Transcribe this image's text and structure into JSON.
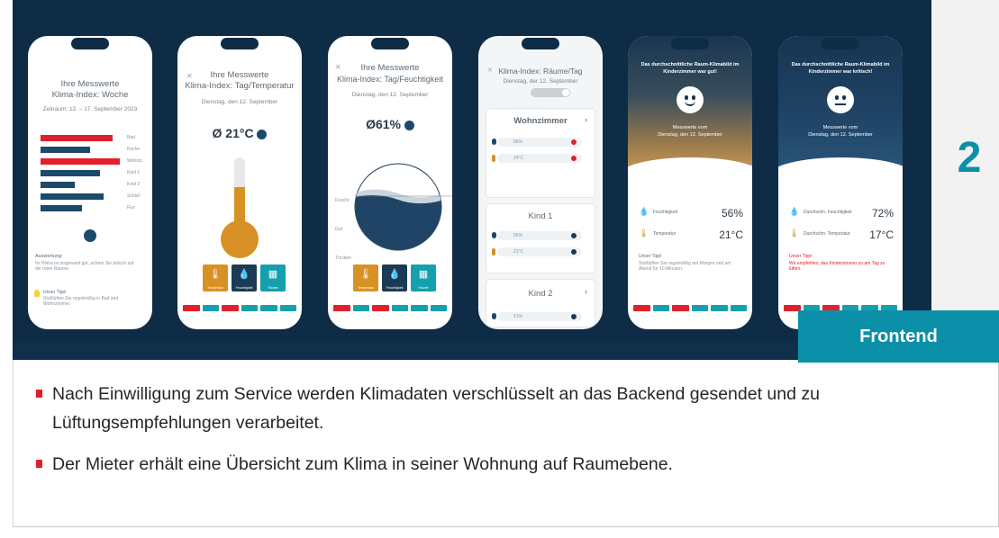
{
  "slide": {
    "step_number": "2",
    "section_tag": "Frontend"
  },
  "phones": {
    "p1": {
      "title1": "Ihre Messwerte",
      "title2": "Klima-Index: Woche",
      "sub": "Zeitraum: 12. – 17. September 2023",
      "bars": [
        {
          "label": "Bad",
          "color": "#e0202c",
          "width": 80
        },
        {
          "label": "Küche",
          "color": "#1b4a6b",
          "width": 55
        },
        {
          "label": "Wohnzi.",
          "color": "#e0202c",
          "width": 88
        },
        {
          "label": "Kind 1",
          "color": "#1b4a6b",
          "width": 66
        },
        {
          "label": "Kind 2",
          "color": "#1b4a6b",
          "width": 38
        },
        {
          "label": "Schlaf.",
          "color": "#1b4a6b",
          "width": 70
        },
        {
          "label": "Flur",
          "color": "#1b4a6b",
          "width": 46
        }
      ],
      "eval_title": "Auswertung:",
      "eval_text": "Ihr Klima ist insgesamt gut, achten Sie jedoch auf die roten Räume.",
      "tip_title": "Unser Tipp!",
      "tip_text": "Stoßlüften Sie regelmäßig in Bad und Wohnzimmer."
    },
    "p2": {
      "title1": "Ihre Messwerte",
      "title2": "Klima-Index: Tag/Temperatur",
      "sub": "Dienstag, den 12. September",
      "value": "Ø 21°C",
      "tile_labels": [
        "Temperatur",
        "Feuchtigkeit",
        "Räume"
      ]
    },
    "p3": {
      "title1": "Ihre Messwerte",
      "title2": "Klima-Index: Tag/Feuchtigkeit",
      "sub": "Dienstag, den 12. September",
      "value": "Ø61%",
      "scale": [
        "Feucht",
        "Gut",
        "Trocken"
      ],
      "tile_labels": [
        "Temperatur",
        "Feuchtigkeit",
        "Räume"
      ]
    },
    "p4": {
      "title": "Klima-Index: Räume/Tag",
      "sub": "Dienstag, der 12. September",
      "rooms": [
        {
          "name": "Wohnzimmer",
          "humidity": "56%",
          "temp": "24°C"
        },
        {
          "name": "Kind 1",
          "humidity": "55%",
          "temp": "21°C"
        },
        {
          "name": "Kind 2",
          "humidity": "51%"
        }
      ]
    },
    "p5": {
      "headline": "Das durchschnittliche Raum-Klimabild im Kinderzimmer war gut!",
      "caption1": "Messwerte vom",
      "caption2": "Dienstag, den 12. September",
      "humidity_label": "Feuchtigkeit",
      "humidity_value": "56%",
      "temp_label": "Temperatur",
      "temp_value": "21°C",
      "tip_title": "Unser Tipp!",
      "tip_text": "Stoßlüften Sie regelmäßig am Morgen und am Abend für 10 Minuten."
    },
    "p6": {
      "headline": "Das durchschnittliche Raum-Klimabild im Kinderzimmer war kritisch!",
      "caption1": "Messwerte vom",
      "caption2": "Dienstag, den 12. September",
      "humidity_label": "Durchschn. Feuchtigkeit",
      "humidity_value": "72%",
      "temp_label": "Durchschn. Temperatur",
      "temp_value": "17°C",
      "tip_title": "Unser Tipp!",
      "tip_text": "Wir empfehlen, das Kinderzimmer zu am Tag zu lüften."
    }
  },
  "bullets": [
    "Nach Einwilligung zum Service werden Klimadaten verschlüsselt an das Backend gesendet und zu Lüftungsempfehlungen verarbeitet.",
    "Der Mieter erhält eine Übersicht zum Klima in seiner Wohnung auf Raumebene."
  ],
  "colors": {
    "banner": "#0e2c45",
    "accent": "#0c8fa9",
    "bullet": "#e0202c",
    "orange": "#d89125"
  }
}
